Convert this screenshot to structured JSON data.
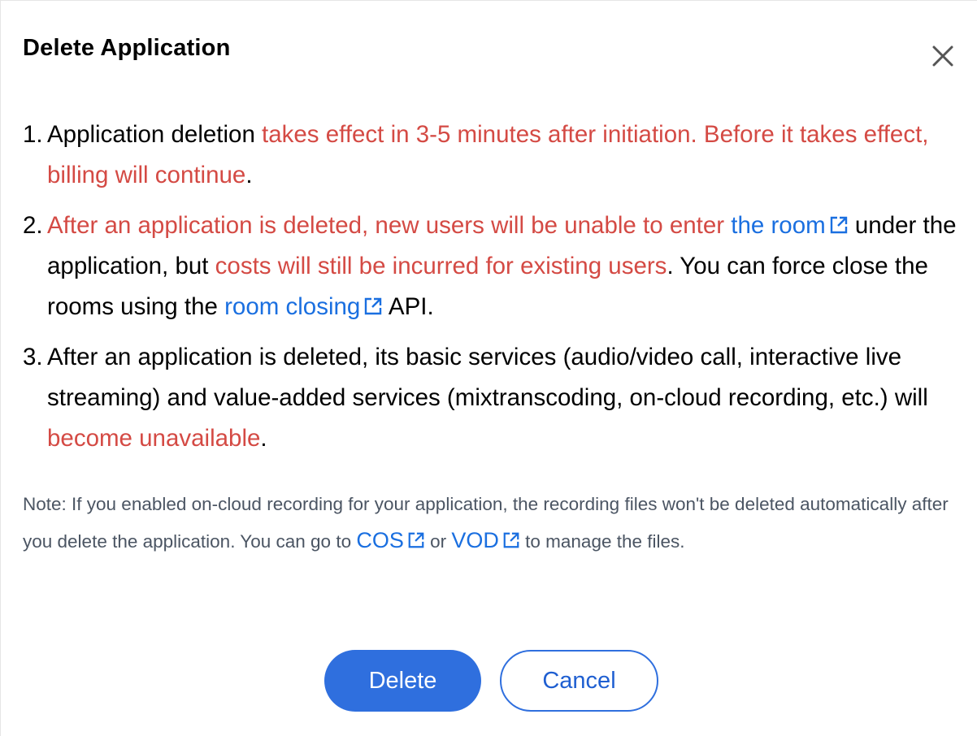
{
  "dialog": {
    "title": "Delete Application",
    "close_icon": "close-icon"
  },
  "items": [
    {
      "num": "1.",
      "t1": "Application deletion ",
      "r1": "takes effect in 3-5 minutes after initiation. Before it takes effect, billing will continue",
      "t2": "."
    },
    {
      "num": "2.",
      "r1": "After an application is deleted, new users will be unable to enter ",
      "link1": "the room",
      "t1": " under the application, but ",
      "r2": "costs will still be incurred for existing users",
      "t2": ". You can force close the rooms using the ",
      "link2": "room closing",
      "t3": " API."
    },
    {
      "num": "3.",
      "t1": "After an application is deleted, its basic services (audio/video call, interactive live streaming) and value-added services (mixtranscoding, on-cloud recording, etc.) will ",
      "r1": "become unavailable",
      "t2": "."
    }
  ],
  "note": {
    "t1": "Note: If you enabled on-cloud recording for your application, the recording files won't be deleted automatically after you delete the application. You can go to ",
    "link_cos": "COS",
    "t2": " or ",
    "link_vod": "VOD",
    "t3": " to manage the files."
  },
  "buttons": {
    "delete_label": "Delete",
    "cancel_label": "Cancel"
  },
  "colors": {
    "accent": "#2f6fde",
    "warning_red": "#d44a44",
    "link": "#1a6fe0",
    "note_text": "#4b5563"
  },
  "icons": [
    "close-icon",
    "external-link-icon"
  ]
}
